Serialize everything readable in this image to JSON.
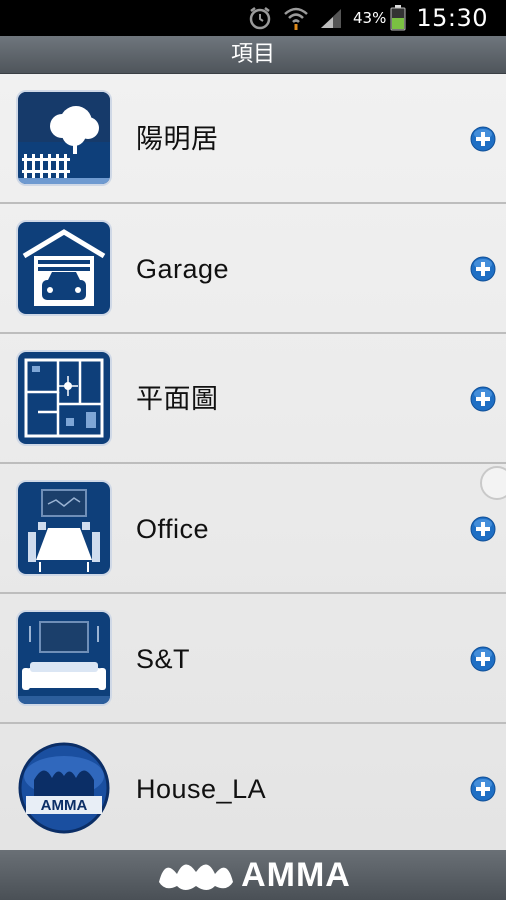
{
  "status_bar": {
    "battery_percent": "43%",
    "time": "15:30",
    "icons": [
      "alarm-icon",
      "wifi-icon",
      "signal-icon",
      "battery-icon"
    ]
  },
  "header": {
    "title": "項目"
  },
  "items": [
    {
      "label": "陽明居",
      "icon": "house-tree-icon"
    },
    {
      "label": "Garage",
      "icon": "garage-icon"
    },
    {
      "label": "平面圖",
      "icon": "floor-plan-icon"
    },
    {
      "label": "Office",
      "icon": "meeting-room-icon"
    },
    {
      "label": "S&T",
      "icon": "living-room-icon"
    },
    {
      "label": "House_LA",
      "icon": "amma-logo-icon"
    }
  ],
  "footer": {
    "brand": "AMMA"
  },
  "colors": {
    "accent_blue": "#1f6fc4",
    "tile_blue": "#0e3f7a"
  }
}
